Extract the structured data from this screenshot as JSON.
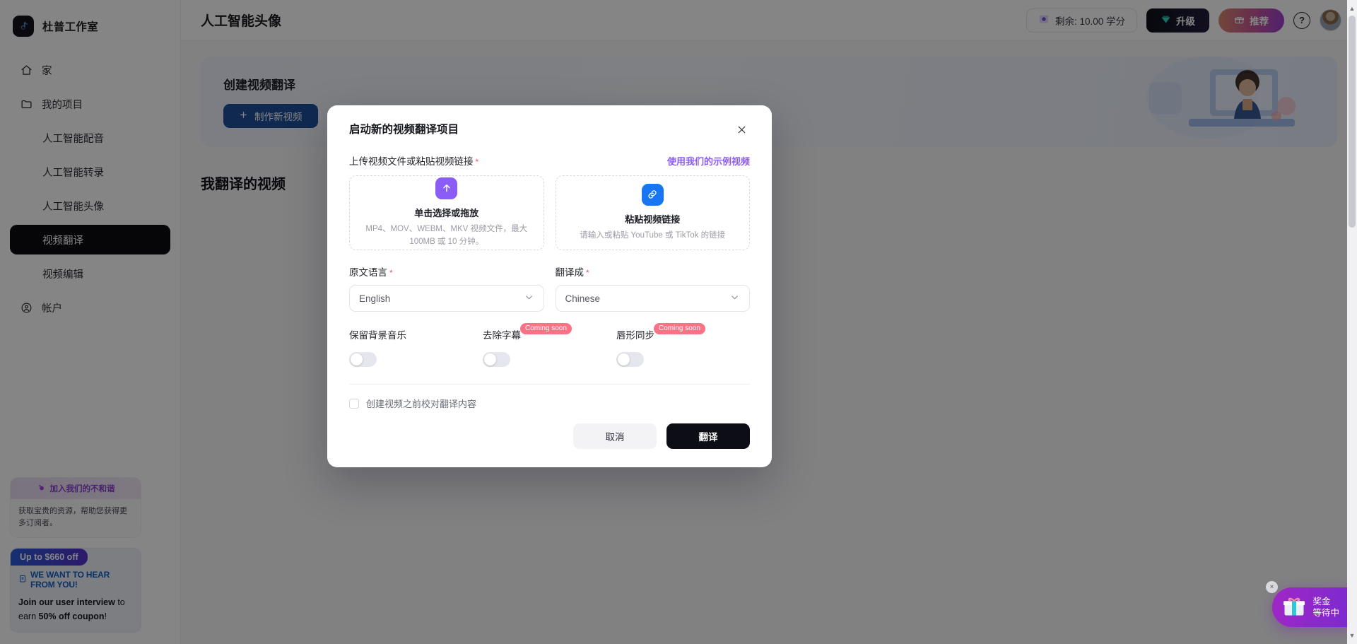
{
  "sidebar": {
    "brand": {
      "name": "杜普工作室",
      "logo_icon": "music-note-logo-icon"
    },
    "items": [
      {
        "label": "家",
        "icon": "home-icon",
        "sub": false,
        "active": false
      },
      {
        "label": "我的项目",
        "icon": "folder-icon",
        "sub": false,
        "active": false
      },
      {
        "label": "人工智能配音",
        "icon": "",
        "sub": true,
        "active": false
      },
      {
        "label": "人工智能转录",
        "icon": "",
        "sub": true,
        "active": false
      },
      {
        "label": "人工智能头像",
        "icon": "",
        "sub": true,
        "active": false
      },
      {
        "label": "视频翻译",
        "icon": "",
        "sub": true,
        "active": true
      },
      {
        "label": "视频编辑",
        "icon": "",
        "sub": true,
        "active": false
      },
      {
        "label": "帐户",
        "icon": "account-circle-icon",
        "sub": false,
        "active": false
      }
    ],
    "promo_discord": {
      "heading": "加入我们的不和谐",
      "sparkle_icon": "sparkle-icon",
      "body": "获取宝贵的资源，帮助您获得更多订阅者。"
    },
    "promo_interview": {
      "tag": "Up to $660 off",
      "heading": "WE WANT TO HEAR FROM YOU!",
      "heading_icon": "clipboard-icon",
      "body_lead": "Join our user interview",
      "body_mid": " to earn ",
      "body_bold": "50% off coupon",
      "body_end": "!"
    }
  },
  "topbar": {
    "page_title": "人工智能头像",
    "credits_label": "剩余: 10.00 学分",
    "credits_icon": "credit-coin-icon",
    "upgrade_label": "升级",
    "upgrade_icon": "diamond-icon",
    "refer_label": "推荐",
    "refer_icon": "gift-icon",
    "help_icon": "question-mark-icon",
    "help_label": "?",
    "avatar_icon": "user-avatar"
  },
  "main": {
    "hero_title": "创建视频翻译",
    "new_video_label": "制作新视频",
    "new_video_icon": "plus-icon",
    "section_title": "我翻译的视频",
    "hero_art_icon": "illustration-woman-at-desk"
  },
  "modal": {
    "title": "启动新的视频翻译项目",
    "close_icon": "close-icon",
    "upload_section_label": "上传视频文件或粘贴视频链接",
    "required_mark": "*",
    "sample_link": "使用我们的示例视频",
    "upload_file": {
      "icon": "upload-arrow-icon",
      "title": "单击选择或拖放",
      "subtitle": "MP4、MOV、WEBM、MKV 视频文件，最大 100MB 或 10 分钟。"
    },
    "paste_link": {
      "icon": "link-chain-icon",
      "title": "粘贴视频链接",
      "subtitle": "请输入或粘贴 YouTube 或 TikTok 的链接"
    },
    "source_language": {
      "label": "原文语言",
      "value": "English",
      "chevron_icon": "chevron-down-icon"
    },
    "target_language": {
      "label": "翻译成",
      "value": "Chinese",
      "chevron_icon": "chevron-down-icon"
    },
    "toggles": [
      {
        "label": "保留背景音乐",
        "badge": "",
        "on": false
      },
      {
        "label": "去除字幕",
        "badge": "Coming soon",
        "on": false
      },
      {
        "label": "唇形同步",
        "badge": "Coming soon",
        "on": false
      }
    ],
    "proofread_checkbox": {
      "label": "创建视频之前校对翻译内容",
      "checked": false
    },
    "cancel_label": "取消",
    "translate_label": "翻译"
  },
  "float_widget": {
    "line1": "奖金",
    "line2": "等待中",
    "gift_icon": "gift-box-icon",
    "close_icon": "close-small-icon",
    "close_label": "×"
  },
  "colors": {
    "accent_purple": "#8b5cf6",
    "accent_blue": "#1876f2",
    "primary_dark": "#0d0d16",
    "hero_button": "#1d4f9c",
    "badge_red": "#fb7185",
    "required_red": "#f2506a"
  }
}
